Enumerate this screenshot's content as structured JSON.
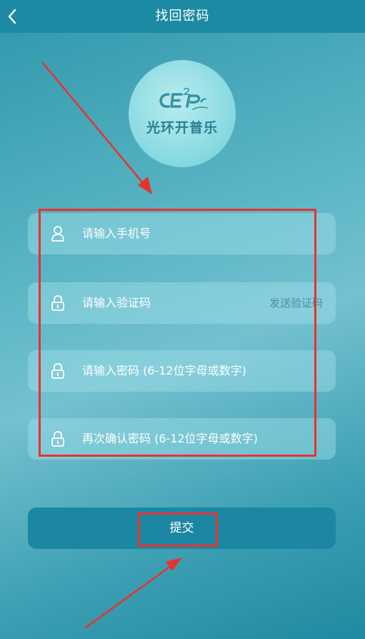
{
  "header": {
    "title": "找回密码"
  },
  "logo": {
    "mark_text": "CE²P",
    "brand_text": "光环开普乐"
  },
  "form": {
    "phone": {
      "placeholder": "请输入手机号",
      "icon": "user-icon"
    },
    "code": {
      "placeholder": "请输入验证码",
      "icon": "lock-icon",
      "send_label": "发送验证码"
    },
    "password": {
      "placeholder": "请输入密码 (6-12位字母或数字)",
      "icon": "lock-icon"
    },
    "confirm": {
      "placeholder": "再次确认密码 (6-12位字母或数字)",
      "icon": "lock-icon"
    }
  },
  "submit_label": "提交",
  "colors": {
    "header_bg": "#1d8aa4",
    "button_bg": "#1b87a3",
    "annotation_red": "#e8322f"
  }
}
